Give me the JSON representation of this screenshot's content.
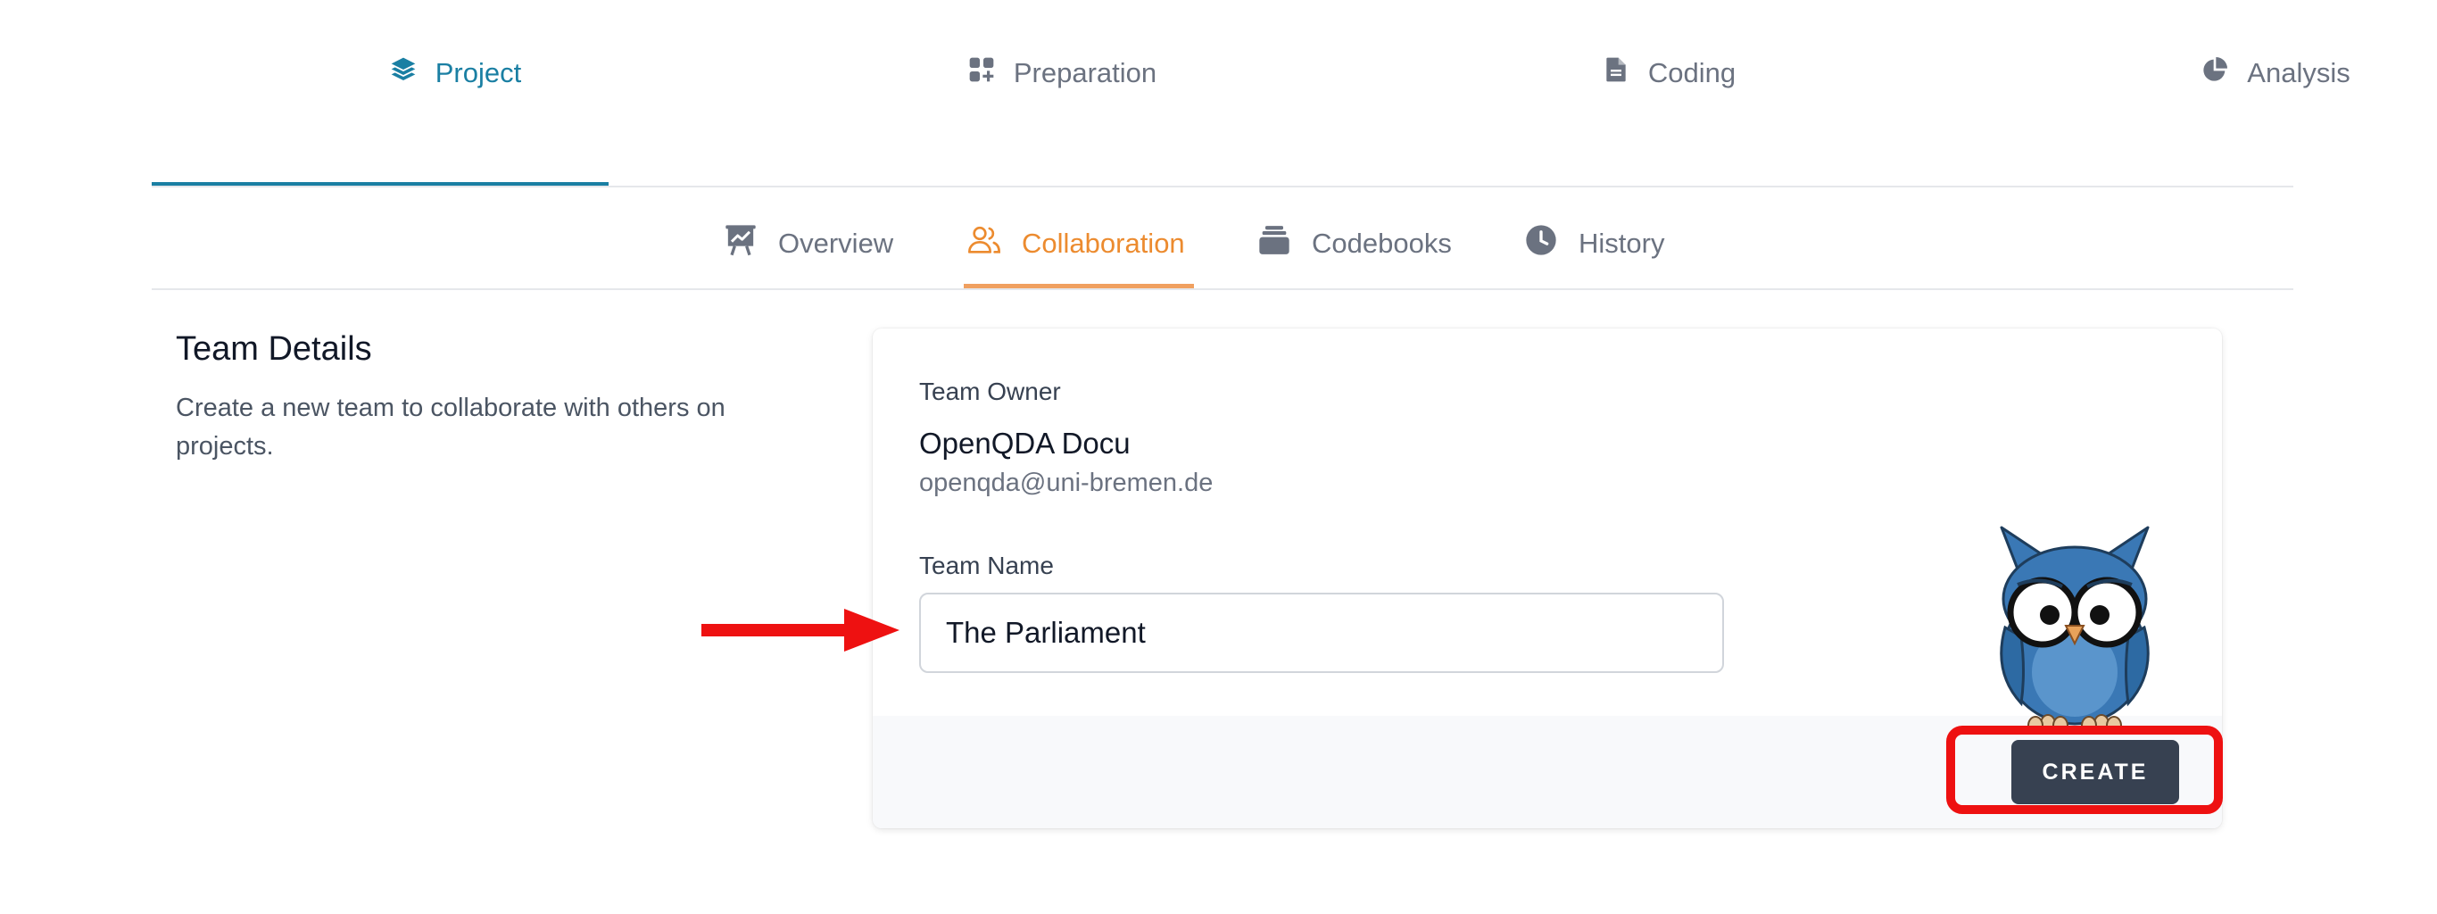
{
  "top_nav": {
    "tabs": [
      {
        "label": "Project",
        "icon": "layers-icon",
        "active": true
      },
      {
        "label": "Preparation",
        "icon": "grid-plus-icon",
        "active": false
      },
      {
        "label": "Coding",
        "icon": "document-icon",
        "active": false
      },
      {
        "label": "Analysis",
        "icon": "pie-chart-icon",
        "active": false
      }
    ]
  },
  "sub_nav": {
    "tabs": [
      {
        "label": "Overview",
        "icon": "presentation-chart-icon",
        "active": false
      },
      {
        "label": "Collaboration",
        "icon": "users-icon",
        "active": true
      },
      {
        "label": "Codebooks",
        "icon": "stack-icon",
        "active": false
      },
      {
        "label": "History",
        "icon": "clock-icon",
        "active": false
      }
    ]
  },
  "section": {
    "title": "Team Details",
    "description": "Create a new team to collaborate with others on projects."
  },
  "form": {
    "owner_label": "Team Owner",
    "owner_name": "OpenQDA Docu",
    "owner_email": "openqda@uni-bremen.de",
    "team_name_label": "Team Name",
    "team_name_value": "The Parliament",
    "create_button": "CREATE"
  },
  "colors": {
    "primary": "#1a7fa3",
    "accent": "#ec8b2f",
    "button": "#374151",
    "annotation": "#ee1111",
    "owl": "#3a78b5"
  },
  "annotations": {
    "arrow": "red-arrow-pointing-right",
    "highlight": "red-rounded-rectangle",
    "mascot": "owl-mascot"
  }
}
